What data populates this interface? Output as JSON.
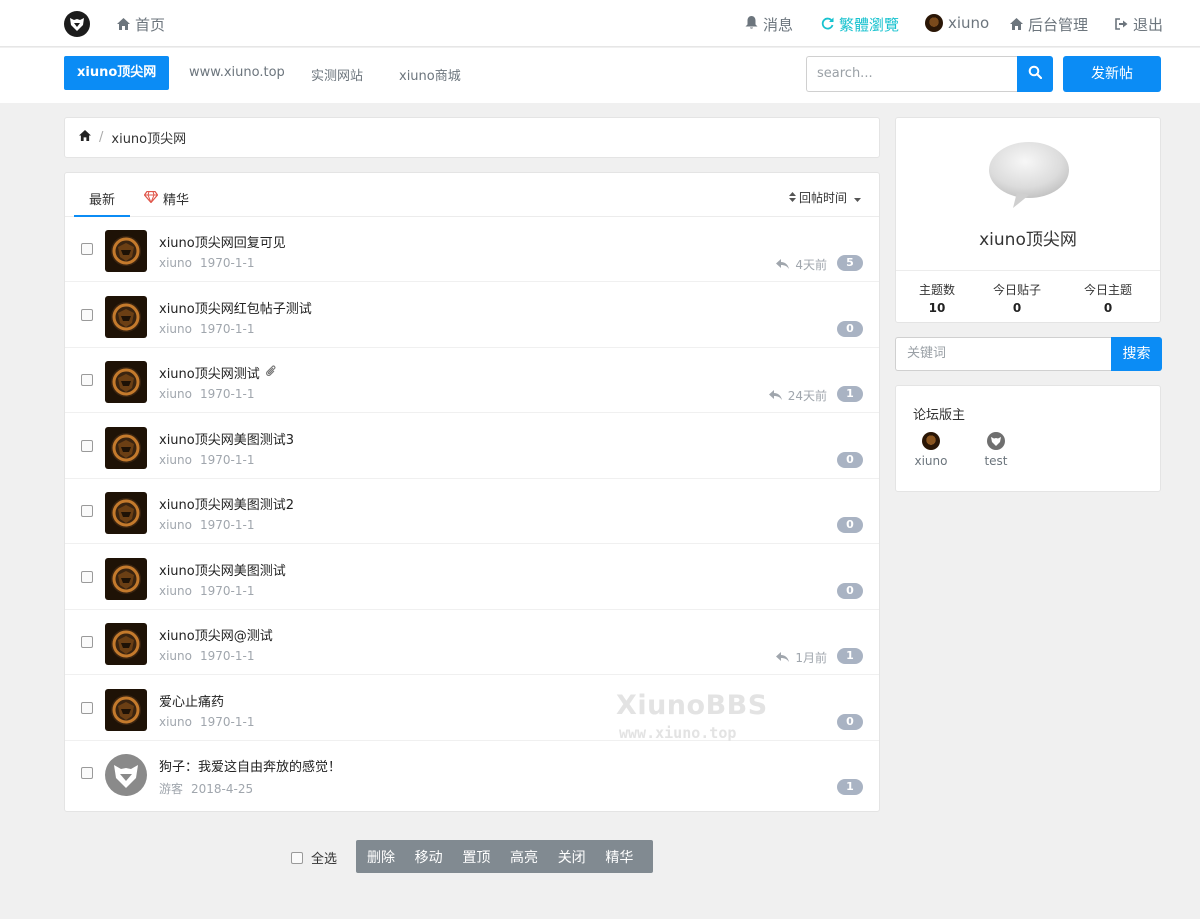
{
  "topbar": {
    "home": "首页",
    "messages": "消息",
    "traditional": "繁體瀏覽",
    "user": "xiuno",
    "admin": "后台管理",
    "logout": "退出"
  },
  "nav": {
    "active": "xiuno顶尖网",
    "links": [
      "www.xiuno.top",
      "实测网站",
      "xiuno商城"
    ],
    "search_placeholder": "search...",
    "new_post": "发新帖"
  },
  "breadcrumb": {
    "current": "xiuno顶尖网"
  },
  "tabs": {
    "latest": "最新",
    "digest": "精华",
    "sort": "回帖时间"
  },
  "threads": [
    {
      "title": "xiuno顶尖网回复可见",
      "user": "xiuno",
      "date": "1970-1-1",
      "last_reply": "4天前",
      "replies": "5",
      "attach": false,
      "avatar": "dark"
    },
    {
      "title": "xiuno顶尖网红包帖子测试",
      "user": "xiuno",
      "date": "1970-1-1",
      "last_reply": "",
      "replies": "0",
      "attach": false,
      "avatar": "dark"
    },
    {
      "title": "xiuno顶尖网测试",
      "user": "xiuno",
      "date": "1970-1-1",
      "last_reply": "24天前",
      "replies": "1",
      "attach": true,
      "avatar": "dark"
    },
    {
      "title": "xiuno顶尖网美图测试3",
      "user": "xiuno",
      "date": "1970-1-1",
      "last_reply": "",
      "replies": "0",
      "attach": false,
      "avatar": "dark"
    },
    {
      "title": "xiuno顶尖网美图测试2",
      "user": "xiuno",
      "date": "1970-1-1",
      "last_reply": "",
      "replies": "0",
      "attach": false,
      "avatar": "dark"
    },
    {
      "title": "xiuno顶尖网美图测试",
      "user": "xiuno",
      "date": "1970-1-1",
      "last_reply": "",
      "replies": "0",
      "attach": false,
      "avatar": "dark"
    },
    {
      "title": "xiuno顶尖网@测试",
      "user": "xiuno",
      "date": "1970-1-1",
      "last_reply": "1月前",
      "replies": "1",
      "attach": false,
      "avatar": "dark"
    },
    {
      "title": "爱心止痛药",
      "user": "xiuno",
      "date": "1970-1-1",
      "last_reply": "",
      "replies": "0",
      "attach": false,
      "avatar": "dark"
    },
    {
      "title": "狗子：我爱这自由奔放的感觉！",
      "user": "游客",
      "date": "2018-4-25",
      "last_reply": "",
      "replies": "1",
      "attach": false,
      "avatar": "guest"
    }
  ],
  "watermark": {
    "line1": "XiunoBBS",
    "line2": "www.xiuno.top"
  },
  "toolbar": {
    "select_all": "全选",
    "actions": [
      "删除",
      "移动",
      "置顶",
      "高亮",
      "关闭",
      "精华"
    ]
  },
  "forum": {
    "name": "xiuno顶尖网",
    "stats": [
      {
        "label": "主题数",
        "value": "10"
      },
      {
        "label": "今日贴子",
        "value": "0"
      },
      {
        "label": "今日主题",
        "value": "0"
      }
    ]
  },
  "side_search": {
    "placeholder": "关键词",
    "button": "搜索"
  },
  "moderators": {
    "title": "论坛版主",
    "list": [
      "xiuno",
      "test"
    ]
  },
  "colors": {
    "primary": "#0b8cf5",
    "cyan": "#17c2cf",
    "badge": "#a9b3c3",
    "toolbar": "#818a91"
  }
}
